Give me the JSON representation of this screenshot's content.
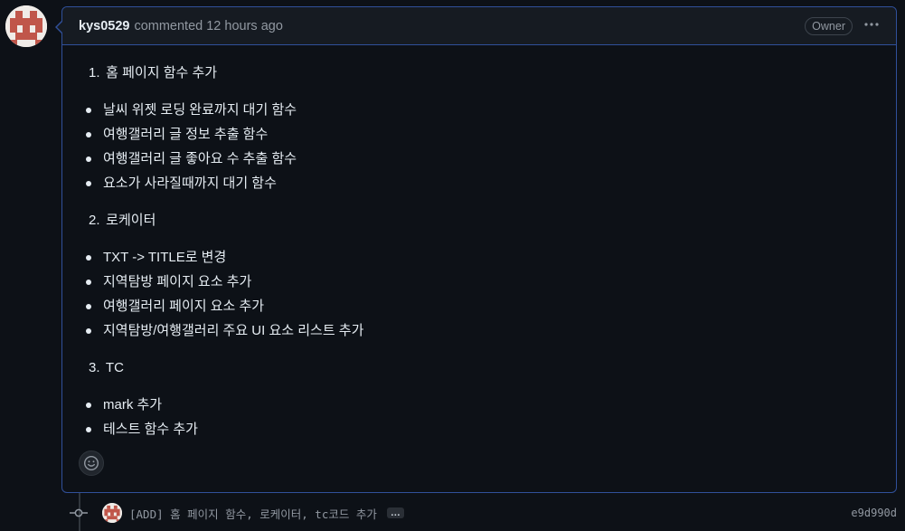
{
  "comment": {
    "author": "kys0529",
    "meta": "commented 12 hours ago",
    "badge": "Owner",
    "sections": [
      {
        "number": "1.",
        "heading": "홈 페이지 함수 추가",
        "items": [
          "날씨 위젯 로딩 완료까지 대기 함수",
          "여행갤러리 글 정보 추출 함수",
          "여행갤러리 글 좋아요 수 추출 함수",
          "요소가 사라질때까지 대기 함수"
        ]
      },
      {
        "number": "2.",
        "heading": "로케이터",
        "items": [
          "TXT -> TITLE로 변경",
          "지역탐방 페이지 요소 추가",
          "여행갤러리 페이지 요소 추가",
          "지역탐방/여행갤러리 주요 UI 요소 리스트 추가"
        ]
      },
      {
        "number": "3.",
        "heading": "TC",
        "items": [
          "mark 추가",
          "테스트 함수 추가"
        ]
      }
    ]
  },
  "commit": {
    "message": "[ADD] 홈 페이지 함수, 로케이터, tc코드 추가",
    "ellipsis": "…",
    "sha": "e9d990d"
  },
  "icons": {
    "more": "kebab-horizontal-icon",
    "reaction": "smiley-icon",
    "commit": "git-commit-icon"
  },
  "colors": {
    "background": "#0d1117",
    "header": "#161b22",
    "border_highlight": "#30509a",
    "muted": "#9198a1",
    "avatar_pattern": "#c0564a"
  }
}
